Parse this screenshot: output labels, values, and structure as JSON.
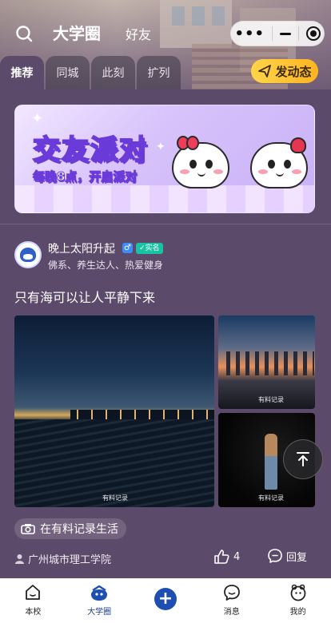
{
  "header": {
    "title": "大学圈",
    "subtitle": "好友",
    "capsule": {
      "more_icon": "more-dots-icon",
      "minimize_icon": "minimize-icon",
      "close_icon": "close-target-icon"
    }
  },
  "tabs": [
    {
      "label": "推荐",
      "active": true
    },
    {
      "label": "同城",
      "active": false
    },
    {
      "label": "此刻",
      "active": false
    },
    {
      "label": "扩列",
      "active": false
    }
  ],
  "publish_label": "发动态",
  "banner": {
    "title": "交友派对",
    "subtitle": "每晚8点，开启派对"
  },
  "post": {
    "username": "晚上太阳升起",
    "gender_symbol": "♂",
    "verified_label": "✓实名",
    "tags": "佛系、养生达人、热爱健身",
    "text": "只有海可以让人平静下来",
    "watermark": "有料记录",
    "topic": "在有料记录生活",
    "school": "广州城市理工学院",
    "likes": "4",
    "reply_label": "回复"
  },
  "bottom_nav": [
    {
      "label": "本校",
      "icon": "home-icon",
      "active": false
    },
    {
      "label": "大学圈",
      "icon": "campus-circle-icon",
      "active": true
    },
    {
      "label": "",
      "icon": "plus-icon",
      "active": false
    },
    {
      "label": "消息",
      "icon": "message-icon",
      "active": false
    },
    {
      "label": "我的",
      "icon": "profile-icon",
      "active": false
    }
  ],
  "colors": {
    "background": "#5c4a6a",
    "publish": "#ffc42e",
    "accent_blue": "#1e4fb0",
    "verified": "#1ac2a5"
  }
}
